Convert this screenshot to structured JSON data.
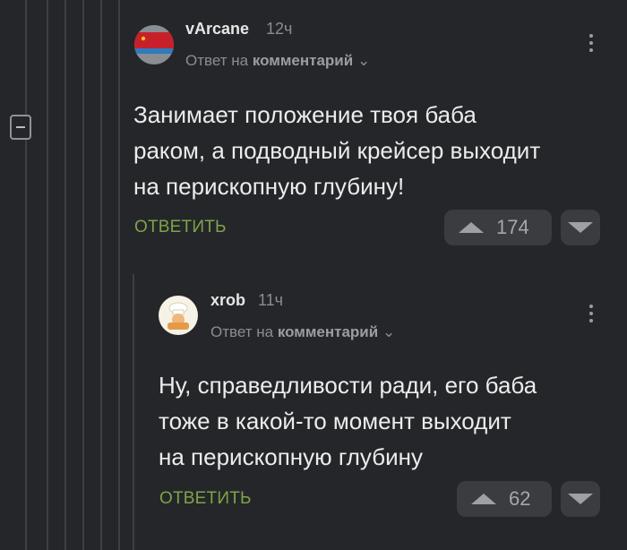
{
  "comments": [
    {
      "username": "vArcane",
      "time": "12ч",
      "reply_prefix": "Ответ на",
      "reply_link": "комментарий",
      "reply_chevron": "⌄",
      "text_lines": [
        "Занимает положение твоя баба",
        "раком, а подводный крейсер выходит",
        "на перископную глубину!"
      ],
      "reply_label": "ОТВЕТИТЬ",
      "votes": "174",
      "avatar_icon": "flag-icon",
      "menu_icon": "more-vertical-icon"
    },
    {
      "username": "xrob",
      "time": "11ч",
      "reply_prefix": "Ответ на",
      "reply_link": "комментарий",
      "reply_chevron": "⌄",
      "text_lines": [
        "Ну, справедливости ради, его баба",
        "тоже в какой-то момент выходит",
        "на перископную глубину"
      ],
      "reply_label": "ОТВЕТИТЬ",
      "votes": "62",
      "avatar_icon": "chef-icon",
      "menu_icon": "more-vertical-icon"
    }
  ],
  "colors": {
    "background": "#252629",
    "reply_green": "#7fa34a",
    "vote_bg": "#3a3c40"
  }
}
